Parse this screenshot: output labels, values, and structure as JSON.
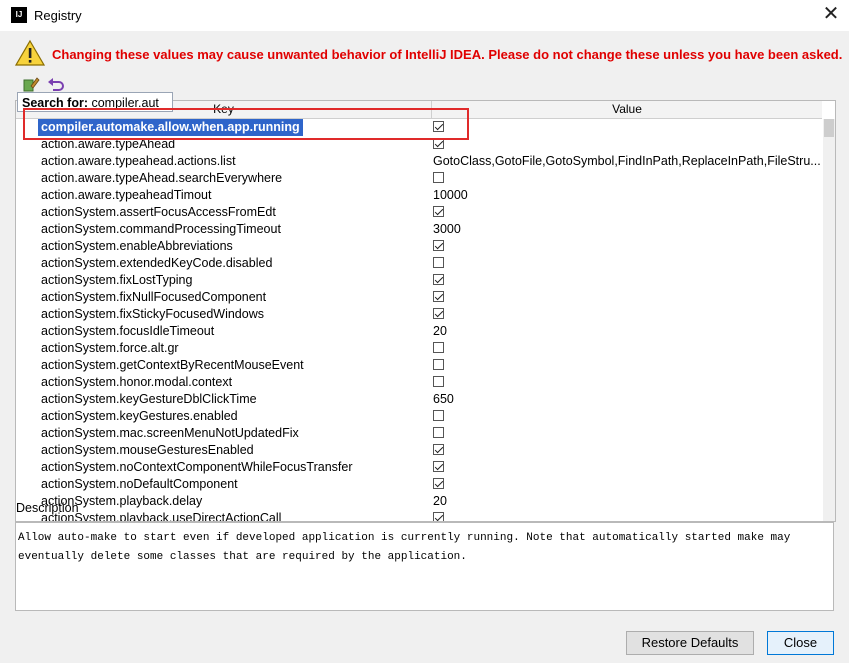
{
  "window": {
    "title": "Registry",
    "logo_text": "IJ"
  },
  "warning": {
    "text": "Changing these values may cause unwanted behavior of IntelliJ IDEA. Please do not change these unless you have been asked."
  },
  "toolbar": {
    "edit_icon": "edit-icon",
    "revert_icon": "undo-icon"
  },
  "table": {
    "headers": {
      "key": "Key",
      "value": "Value"
    },
    "rows": [
      {
        "key": "compiler.automake.allow.when.app.running",
        "type": "bool",
        "checked": true,
        "selected": true
      },
      {
        "key": "action.aware.typeAhead",
        "type": "bool",
        "checked": true
      },
      {
        "key": "action.aware.typeahead.actions.list",
        "type": "text",
        "value": "GotoClass,GotoFile,GotoSymbol,FindInPath,ReplaceInPath,FileStru..."
      },
      {
        "key": "action.aware.typeAhead.searchEverywhere",
        "type": "bool",
        "checked": false
      },
      {
        "key": "action.aware.typeaheadTimout",
        "type": "text",
        "value": "10000"
      },
      {
        "key": "actionSystem.assertFocusAccessFromEdt",
        "type": "bool",
        "checked": true
      },
      {
        "key": "actionSystem.commandProcessingTimeout",
        "type": "text",
        "value": "3000"
      },
      {
        "key": "actionSystem.enableAbbreviations",
        "type": "bool",
        "checked": true
      },
      {
        "key": "actionSystem.extendedKeyCode.disabled",
        "type": "bool",
        "checked": false
      },
      {
        "key": "actionSystem.fixLostTyping",
        "type": "bool",
        "checked": true
      },
      {
        "key": "actionSystem.fixNullFocusedComponent",
        "type": "bool",
        "checked": true
      },
      {
        "key": "actionSystem.fixStickyFocusedWindows",
        "type": "bool",
        "checked": true
      },
      {
        "key": "actionSystem.focusIdleTimeout",
        "type": "text",
        "value": "20"
      },
      {
        "key": "actionSystem.force.alt.gr",
        "type": "bool",
        "checked": false
      },
      {
        "key": "actionSystem.getContextByRecentMouseEvent",
        "type": "bool",
        "checked": false
      },
      {
        "key": "actionSystem.honor.modal.context",
        "type": "bool",
        "checked": false
      },
      {
        "key": "actionSystem.keyGestureDblClickTime",
        "type": "text",
        "value": "650"
      },
      {
        "key": "actionSystem.keyGestures.enabled",
        "type": "bool",
        "checked": false
      },
      {
        "key": "actionSystem.mac.screenMenuNotUpdatedFix",
        "type": "bool",
        "checked": false
      },
      {
        "key": "actionSystem.mouseGesturesEnabled",
        "type": "bool",
        "checked": true
      },
      {
        "key": "actionSystem.noContextComponentWhileFocusTransfer",
        "type": "bool",
        "checked": true
      },
      {
        "key": "actionSystem.noDefaultComponent",
        "type": "bool",
        "checked": true
      },
      {
        "key": "actionSystem.playback.delay",
        "type": "text",
        "value": "20"
      },
      {
        "key": "actionSystem.playback.useDirectActionCall",
        "type": "bool",
        "checked": true
      }
    ]
  },
  "search": {
    "label": "Search for:",
    "value": "compiler.aut"
  },
  "description": {
    "label": "Description",
    "text": "Allow auto-make to start even if developed application is currently running. Note that automatically started make may eventually delete some classes that are required by the application."
  },
  "buttons": {
    "restore": "Restore Defaults",
    "close": "Close"
  },
  "colors": {
    "warning": "#e00000",
    "selection": "#2f65ca",
    "highlight": "#e02a2a"
  }
}
